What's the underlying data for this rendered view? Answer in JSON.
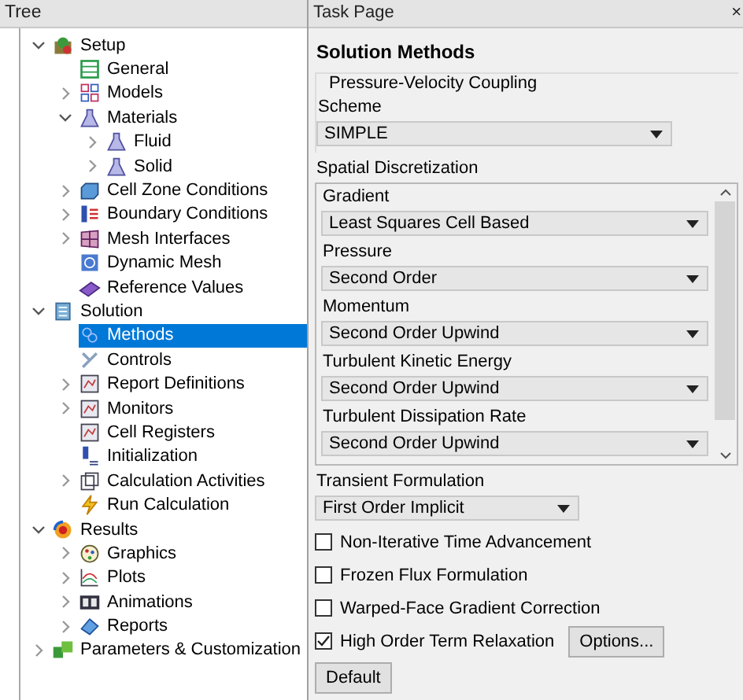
{
  "tree": {
    "title": "Tree",
    "items": [
      {
        "label": "Setup",
        "kind": "setup",
        "expanded": true,
        "selected": false,
        "children": [
          {
            "label": "General",
            "kind": "grid",
            "selected": false
          },
          {
            "label": "Models",
            "kind": "models",
            "expanded": false,
            "selected": false
          },
          {
            "label": "Materials",
            "kind": "flask",
            "expanded": true,
            "selected": false,
            "children": [
              {
                "label": "Fluid",
                "kind": "flask",
                "expanded": false,
                "selected": false
              },
              {
                "label": "Solid",
                "kind": "flask",
                "expanded": false,
                "selected": false
              }
            ]
          },
          {
            "label": "Cell Zone Conditions",
            "kind": "cube",
            "expanded": false,
            "selected": false
          },
          {
            "label": "Boundary Conditions",
            "kind": "boundary",
            "expanded": false,
            "selected": false
          },
          {
            "label": "Mesh Interfaces",
            "kind": "mesh",
            "expanded": false,
            "selected": false
          },
          {
            "label": "Dynamic Mesh",
            "kind": "dynamic",
            "selected": false
          },
          {
            "label": "Reference Values",
            "kind": "book",
            "selected": false
          }
        ]
      },
      {
        "label": "Solution",
        "kind": "solution",
        "expanded": true,
        "selected": false,
        "children": [
          {
            "label": "Methods",
            "kind": "methods",
            "selected": true
          },
          {
            "label": "Controls",
            "kind": "controls",
            "selected": false
          },
          {
            "label": "Report Definitions",
            "kind": "chart",
            "expanded": false,
            "selected": false
          },
          {
            "label": "Monitors",
            "kind": "chart",
            "expanded": false,
            "selected": false
          },
          {
            "label": "Cell Registers",
            "kind": "chart",
            "selected": false
          },
          {
            "label": "Initialization",
            "kind": "init",
            "selected": false
          },
          {
            "label": "Calculation Activities",
            "kind": "activities",
            "expanded": false,
            "selected": false
          },
          {
            "label": "Run Calculation",
            "kind": "bolt",
            "selected": false
          }
        ]
      },
      {
        "label": "Results",
        "kind": "results",
        "expanded": true,
        "selected": false,
        "children": [
          {
            "label": "Graphics",
            "kind": "graphics",
            "expanded": false,
            "selected": false
          },
          {
            "label": "Plots",
            "kind": "plots",
            "expanded": false,
            "selected": false
          },
          {
            "label": "Animations",
            "kind": "film",
            "expanded": false,
            "selected": false
          },
          {
            "label": "Reports",
            "kind": "reports",
            "expanded": false,
            "selected": false
          }
        ]
      },
      {
        "label": "Parameters & Customization",
        "kind": "params",
        "expanded": false,
        "selected": false
      }
    ]
  },
  "task_page": {
    "title": "Task Page",
    "close": "×",
    "heading": "Solution Methods",
    "coupling": {
      "legend": "Pressure-Velocity Coupling",
      "label": "Scheme",
      "value": "SIMPLE"
    },
    "spatial": {
      "title": "Spatial Discretization",
      "fields": [
        {
          "label": "Gradient",
          "value": "Least Squares Cell Based"
        },
        {
          "label": "Pressure",
          "value": "Second Order"
        },
        {
          "label": "Momentum",
          "value": "Second Order Upwind"
        },
        {
          "label": "Turbulent Kinetic Energy",
          "value": "Second Order Upwind"
        },
        {
          "label": "Turbulent Dissipation Rate",
          "value": "Second Order Upwind"
        }
      ]
    },
    "transient": {
      "label": "Transient Formulation",
      "value": "First Order Implicit"
    },
    "options": [
      {
        "label": "Non-Iterative Time Advancement",
        "checked": false
      },
      {
        "label": "Frozen Flux Formulation",
        "checked": false
      },
      {
        "label": "Warped-Face Gradient Correction",
        "checked": false
      },
      {
        "label": "High Order Term Relaxation",
        "checked": true,
        "button": "Options..."
      }
    ],
    "default_button": "Default"
  }
}
